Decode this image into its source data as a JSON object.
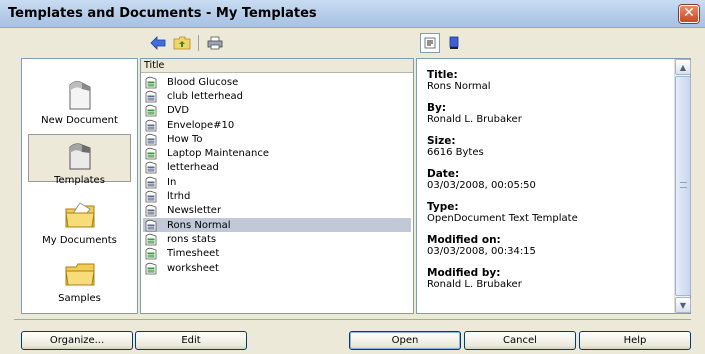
{
  "window": {
    "title": "Templates and Documents - My Templates"
  },
  "toolbar": {
    "left": [
      {
        "icon": "back-arrow-icon"
      },
      {
        "icon": "folder-up-icon"
      },
      {
        "icon": "print-icon"
      }
    ],
    "right": [
      {
        "icon": "document-properties-icon",
        "pressed": true
      },
      {
        "icon": "preview-icon",
        "pressed": false
      }
    ]
  },
  "categories": [
    {
      "label": "New Document",
      "icon": "new-document-icon",
      "selected": false
    },
    {
      "label": "Templates",
      "icon": "templates-icon",
      "selected": true
    },
    {
      "label": "My Documents",
      "icon": "my-documents-folder-icon",
      "selected": false
    },
    {
      "label": "Samples",
      "icon": "samples-folder-icon",
      "selected": false
    }
  ],
  "list": {
    "header": "Title",
    "items": [
      {
        "name": "Blood Glucose",
        "type": "spreadsheet",
        "selected": false
      },
      {
        "name": "club letterhead",
        "type": "text",
        "selected": false
      },
      {
        "name": "DVD",
        "type": "spreadsheet",
        "selected": false
      },
      {
        "name": "Envelope#10",
        "type": "text",
        "selected": false
      },
      {
        "name": "How To",
        "type": "text",
        "selected": false
      },
      {
        "name": "Laptop Maintenance",
        "type": "spreadsheet",
        "selected": false
      },
      {
        "name": "letterhead",
        "type": "text",
        "selected": false
      },
      {
        "name": "In",
        "type": "text",
        "selected": false
      },
      {
        "name": "ltrhd",
        "type": "text",
        "selected": false
      },
      {
        "name": "Newsletter",
        "type": "text",
        "selected": false
      },
      {
        "name": "Rons Normal",
        "type": "text",
        "selected": true
      },
      {
        "name": "rons stats",
        "type": "spreadsheet",
        "selected": false
      },
      {
        "name": "Timesheet",
        "type": "spreadsheet",
        "selected": false
      },
      {
        "name": "worksheet",
        "type": "spreadsheet",
        "selected": false
      }
    ]
  },
  "info": {
    "fields": [
      {
        "key": "Title:",
        "value": "Rons Normal"
      },
      {
        "key": "By:",
        "value": "Ronald L. Brubaker"
      },
      {
        "key": "Size:",
        "value": "6616 Bytes"
      },
      {
        "key": "Date:",
        "value": "03/03/2008, 00:05:50"
      },
      {
        "key": "Type:",
        "value": "OpenDocument Text Template"
      },
      {
        "key": "Modified on:",
        "value": "03/03/2008, 00:34:15"
      },
      {
        "key": "Modified by:",
        "value": "Ronald L. Brubaker"
      }
    ]
  },
  "buttons": {
    "organize": "Organize...",
    "edit": "Edit",
    "open": "Open",
    "cancel": "Cancel",
    "help": "Help"
  },
  "colors": {
    "selection": "#c1c8d6",
    "title_bar": "#b3cbe8",
    "close": "#c9482a",
    "spreadsheet_icon": "#3a9a3a",
    "text_icon": "#5a6a8a"
  }
}
